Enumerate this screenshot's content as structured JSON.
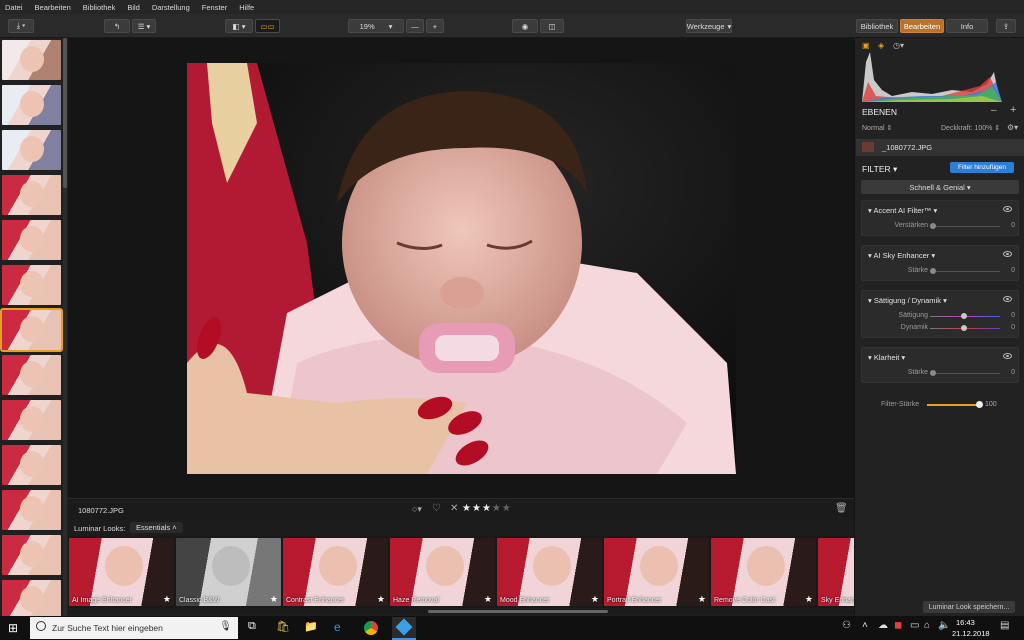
{
  "menu": [
    "Datei",
    "Bearbeiten",
    "Bibliothek",
    "Bild",
    "Darstellung",
    "Fenster",
    "Hilfe"
  ],
  "toolbar": {
    "zoom": "19%",
    "minus": "—",
    "plus": "+",
    "tools": "Werkzeuge",
    "tab_library": "Bibliothek",
    "tab_edit": "Bearbeiten",
    "tab_info": "Info"
  },
  "photo": {
    "filename": "1080772.JPG",
    "rating": 3,
    "rating_max": 5
  },
  "looks": {
    "label": "Luminar Looks:",
    "category": "Essentials",
    "items": [
      "AI Image Enhancer",
      "Classic B&W",
      "Contrast Enhancer",
      "Haze Removal",
      "Mood Enhancer",
      "Portrait Enhancer",
      "Remove Color Cast",
      "Sky Enhancer"
    ],
    "save_button": "Luminar Look speichern..."
  },
  "panel": {
    "layers_title": "EBENEN",
    "blend_mode": "Normal",
    "opacity_label": "Deckkraft: 100%",
    "layer_name": "_1080772.JPG",
    "filter_title": "FILTER",
    "add_filter": "Filter hinzufügen",
    "workspace": "Schnell & Genial",
    "filters": [
      {
        "name": "Accent AI Filter™",
        "sliders": [
          {
            "label": "Verstärken",
            "value": "0"
          }
        ]
      },
      {
        "name": "AI Sky Enhancer",
        "sliders": [
          {
            "label": "Stärke",
            "value": "0"
          }
        ]
      },
      {
        "name": "Sättigung / Dynamik",
        "sliders": [
          {
            "label": "Sättigung",
            "value": "0"
          },
          {
            "label": "Dynamik",
            "value": "0"
          }
        ]
      },
      {
        "name": "Klarheit",
        "sliders": [
          {
            "label": "Stärke",
            "value": "0"
          }
        ]
      }
    ],
    "filter_strength_label": "Filter-Stärke",
    "filter_strength_value": "100"
  },
  "taskbar": {
    "search_placeholder": "Zur Suche Text hier eingeben",
    "time": "16:43",
    "date": "21.12.2018"
  },
  "colors": {
    "accent": "#e8a020",
    "active_tab": "#b8722a",
    "add_filter_btn": "#2d7fd6"
  }
}
